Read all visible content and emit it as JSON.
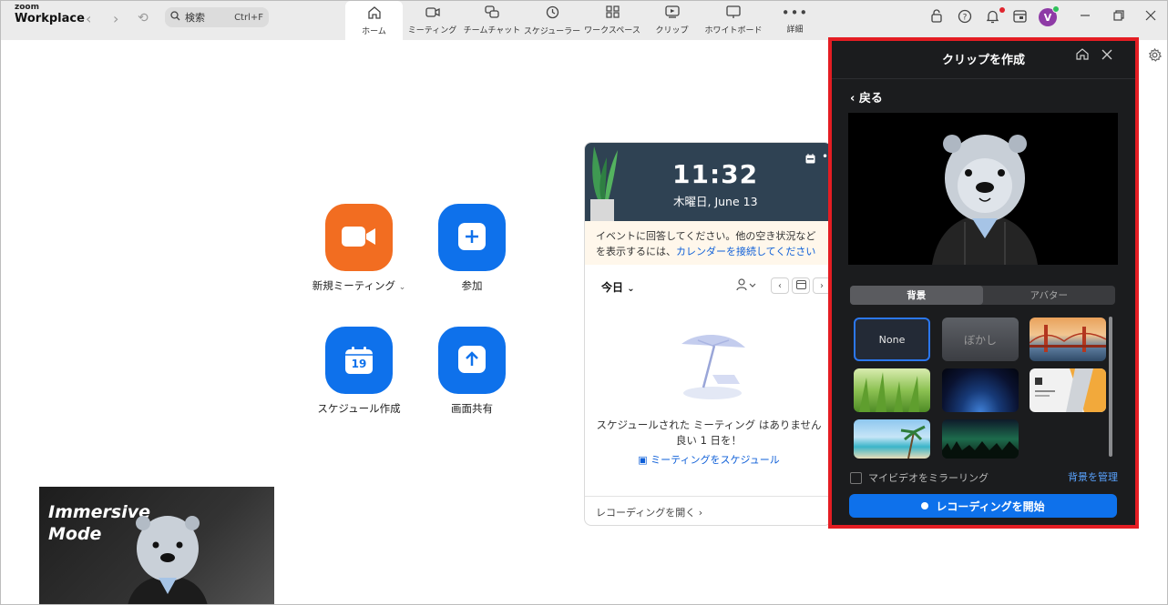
{
  "app": {
    "logo_top": "zoom",
    "logo_bottom": "Workplace"
  },
  "search": {
    "label": "検索",
    "shortcut": "Ctrl+F"
  },
  "tabs": [
    {
      "label": "ホーム",
      "icon": "home-icon"
    },
    {
      "label": "ミーティング",
      "icon": "video-icon"
    },
    {
      "label": "チームチャット",
      "icon": "chat-icon"
    },
    {
      "label": "スケジューラー",
      "icon": "clock-icon"
    },
    {
      "label": "ワークスペース",
      "icon": "grid-icon"
    },
    {
      "label": "クリップ",
      "icon": "clip-icon"
    },
    {
      "label": "ホワイトボード",
      "icon": "whiteboard-icon"
    },
    {
      "label": "詳細",
      "icon": "more-icon"
    }
  ],
  "user": {
    "initial": "V"
  },
  "home": {
    "new_meeting": "新規ミーティング",
    "join": "参加",
    "schedule": "スケジュール作成",
    "share": "画面共有",
    "calendar_day": "19"
  },
  "calendar": {
    "time": "11:32",
    "date": "木曜日, June 13",
    "notice_text": "イベントに回答してください。他の空き状況などを表示するには、",
    "notice_link": "カレンダーを接続してください",
    "today_label": "今日",
    "empty_line1": "スケジュールされた ミーティング はありません",
    "empty_line2": "良い 1 日を！",
    "schedule_link": "ミーティングをスケジュール",
    "open_recordings": "レコーディングを開く"
  },
  "immersive": {
    "line1": "Immersive",
    "line2": "Mode"
  },
  "clip_panel": {
    "title": "クリップを作成",
    "back_label": "戻る",
    "tab_background": "背景",
    "tab_avatar": "アバター",
    "bg_none": "None",
    "bg_blur": "ぼかし",
    "mirror_label": "マイビデオをミラーリング",
    "manage_label": "背景を管理",
    "start_label": "レコーディングを開始"
  },
  "colors": {
    "brand_blue": "#0e71eb",
    "orange": "#f26d21",
    "highlight_red": "#e41d23",
    "panel_bg": "#1b1c1e"
  }
}
